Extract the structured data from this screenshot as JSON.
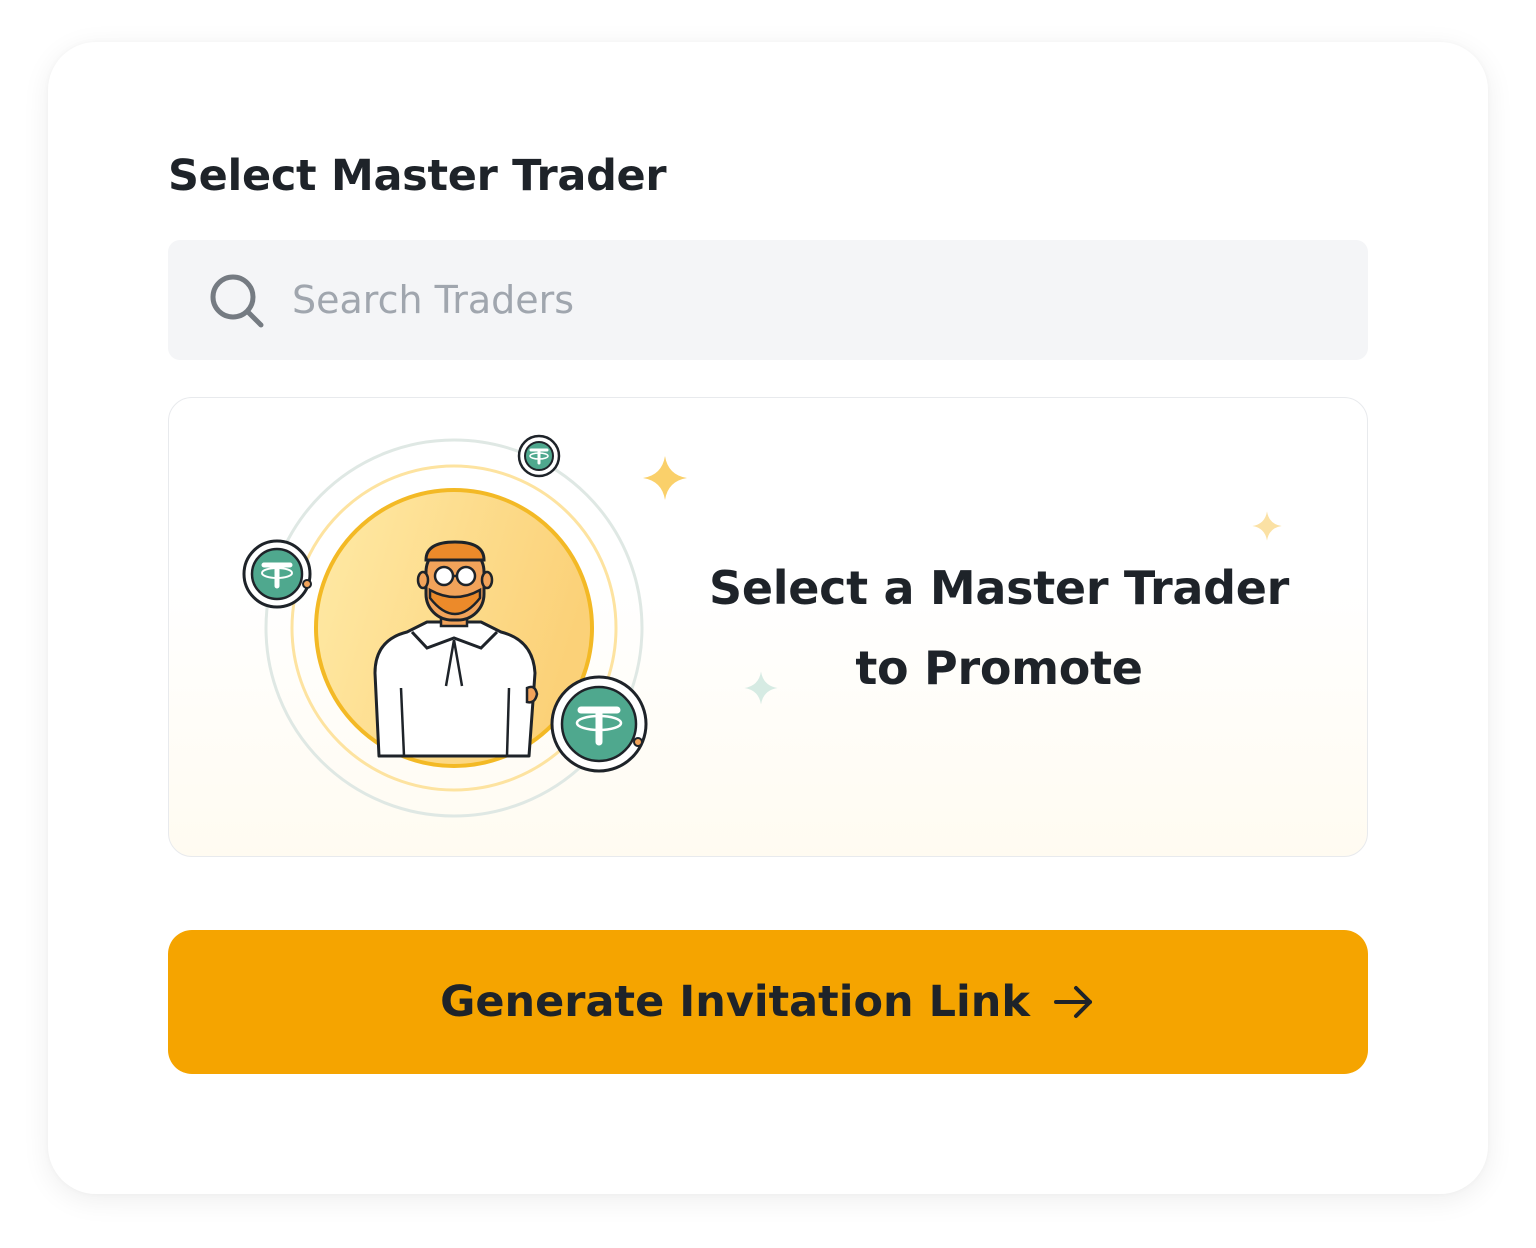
{
  "section": {
    "title": "Select Master Trader"
  },
  "search": {
    "placeholder": "Search Traders",
    "value": "",
    "icon": "search-icon"
  },
  "promo": {
    "line1": "Select a Master Trader",
    "line2": "to Promote",
    "illustration": "master-trader-avatar-with-usdt-coins"
  },
  "action": {
    "label": "Generate Invitation Link",
    "icon": "arrow-right-icon"
  },
  "colors": {
    "accent": "#f5a400",
    "text": "#1e2329",
    "placeholder": "#a0a6ae",
    "input_bg": "#f4f5f7",
    "coin_green": "#4fa88e"
  }
}
